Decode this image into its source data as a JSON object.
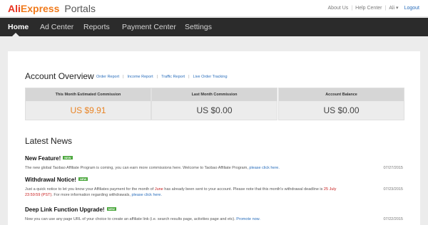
{
  "header": {
    "logo_ali": "Ali",
    "logo_express": "Express",
    "logo_portals": "Portals",
    "links": {
      "about": "About Us",
      "help": "Help Center",
      "user": "Ali ▾",
      "logout": "Logout"
    }
  },
  "nav": {
    "items": [
      "Home",
      "Ad Center",
      "Reports",
      "Payment Center",
      "Settings"
    ],
    "active_index": 0
  },
  "account_overview": {
    "title": "Account Overview",
    "links": [
      "Order Report",
      "Income Report",
      "Traffic Report",
      "Live Order Tracking"
    ],
    "cards": [
      {
        "label": "This Month Estimated Commission",
        "value": "US $9.91"
      },
      {
        "label": "Last Month Commission",
        "value": "US $0.00"
      },
      {
        "label": "Account Balance",
        "value": "US $0.00"
      }
    ]
  },
  "latest_news": {
    "title": "Latest News",
    "badge": "NEW",
    "items": [
      {
        "title": "New Feature!",
        "body": "The new global Taobao Affiliate Program is coming, you can earn more commissions here. Welcome to Taobao Affiliate Program,",
        "link": "please click here.",
        "date": "07/27/2015"
      },
      {
        "title": "Withdrawal Notice!",
        "body_1": "Just a quick notice to let you know your Affiliates payment for the month of",
        "month": "June",
        "body_2": "has already been sent to your account. Please note that this month's withdrawal deadline is",
        "deadline": "25 July 23:59:59 (PST)",
        "body_3": ". For more information regarding withdrawals,",
        "link": "please click here.",
        "date": "07/23/2015"
      },
      {
        "title": "Deep Link Function Upgrade!",
        "body": "Now you can use any page URL of your choice to create an affiliate link (i.e. search results page, activities page and etc).",
        "link": "Promote now.",
        "date": "07/22/2015"
      }
    ]
  },
  "colors": {
    "brand_red": "#e8321e",
    "brand_orange": "#f07a1b",
    "nav_bg": "#2b2b2b",
    "link_blue": "#2a6ebb",
    "badge_green": "#4aa73c",
    "commission_orange": "#e98425"
  }
}
